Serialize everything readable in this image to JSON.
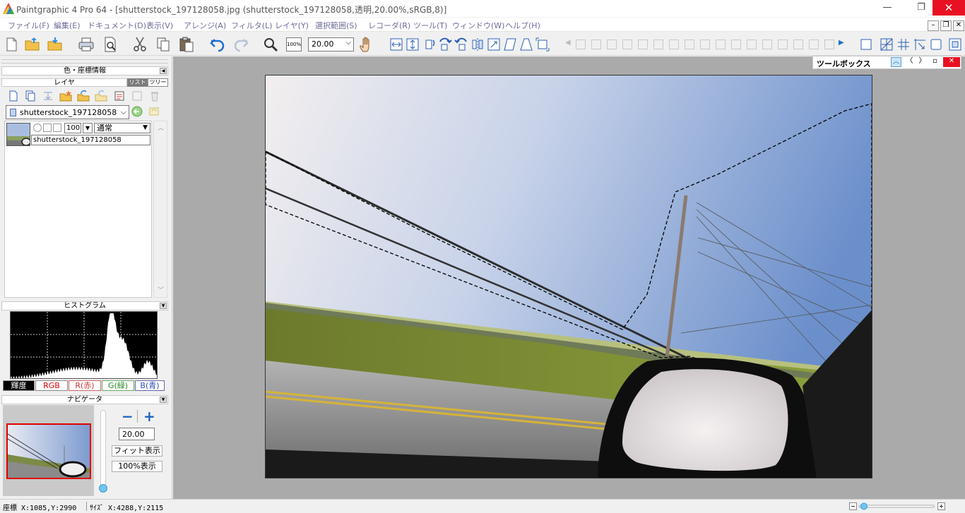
{
  "window": {
    "title": "Paintgraphic 4 Pro 64 - [shutterstock_197128058.jpg (shutterstock_197128058,透明,20.00%,sRGB,8)]",
    "minimize": "—",
    "maximize": "❐",
    "close": "✕"
  },
  "menu": [
    "ファイル(F)",
    "編集(E)",
    "ドキュメント(D)",
    "表示(V)",
    "アレンジ(A)",
    "フィルタ(L)",
    "レイヤ(Y)",
    "選択範囲(S)",
    "レコーダ(R)",
    "ツール(T)",
    "ウィンドウ(W)",
    "ヘルプ(H)"
  ],
  "mdi": {
    "minimize": "–",
    "restore": "❐",
    "close": "✕"
  },
  "toolbar": {
    "zoom_100_label": "100%",
    "zoom_value": "20.00"
  },
  "panels": {
    "color_info": "色・座標情報",
    "layer": "レイヤ",
    "layer_tab_list": "リスト",
    "layer_tab_tree": "ツリー",
    "histogram": "ヒストグラム",
    "navigator": "ナビゲータ"
  },
  "layer": {
    "document": "shutterstock_197128058",
    "opacity": "100",
    "blend_mode": "通常",
    "name": "shutterstock_197128058"
  },
  "histogram": {
    "channels": [
      "輝度",
      "RGB",
      "R(赤)",
      "G(緑)",
      "B(青)"
    ],
    "selected": "輝度"
  },
  "navigator": {
    "minus": "−",
    "plus": "+",
    "zoom": "20.00",
    "fit_button": "フィット表示",
    "actual_button": "100%表示",
    "zoom_slider_level": 0.05
  },
  "toolbox": {
    "title": "ツールボックス"
  },
  "status": {
    "coords": "座標 X:1085,Y:2990",
    "size": "ｻｲｽﾞ X:4288,Y:2115"
  },
  "colors": {
    "close_red": "#e81123",
    "menu_text": "#6d6d9a",
    "canvas_gray": "#aaaaaa",
    "nav_frame": "#e00000"
  }
}
